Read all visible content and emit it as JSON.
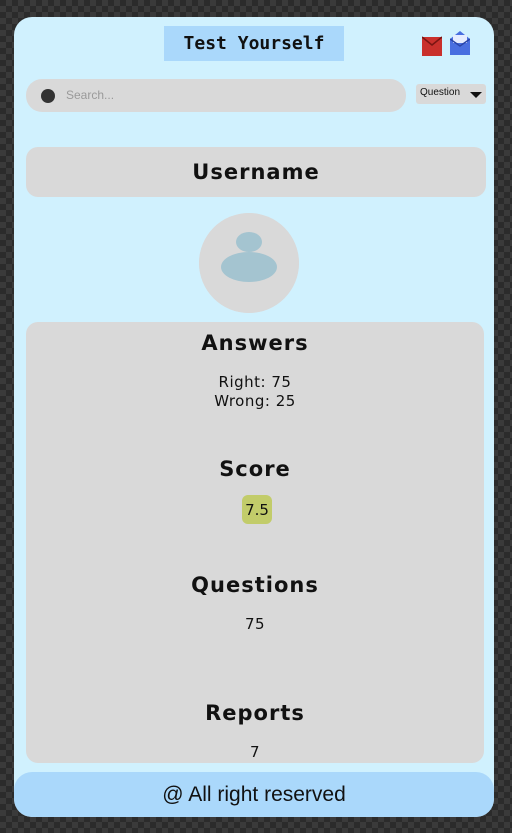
{
  "header": {
    "title": "Test Yourself",
    "icons": [
      "mail-icon",
      "mail-open-icon"
    ]
  },
  "search": {
    "placeholder": "Search...",
    "filter_selected": "Question"
  },
  "profile": {
    "username": "Username"
  },
  "stats": {
    "answers_title": "Answers",
    "right": "Right: 75",
    "wrong": "Wrong: 25",
    "score_title": "Score",
    "score_value": "7.5",
    "questions_title": "Questions",
    "questions_value": "75",
    "reports_title": "Reports",
    "reports_value": "7"
  },
  "footer": {
    "text": "@ All right reserved"
  },
  "colors": {
    "page_bg": "#d0f1fe",
    "accent_blue": "#aad8fb",
    "card_gray": "#d9d9d9",
    "score_badge": "#c2cc6a"
  }
}
